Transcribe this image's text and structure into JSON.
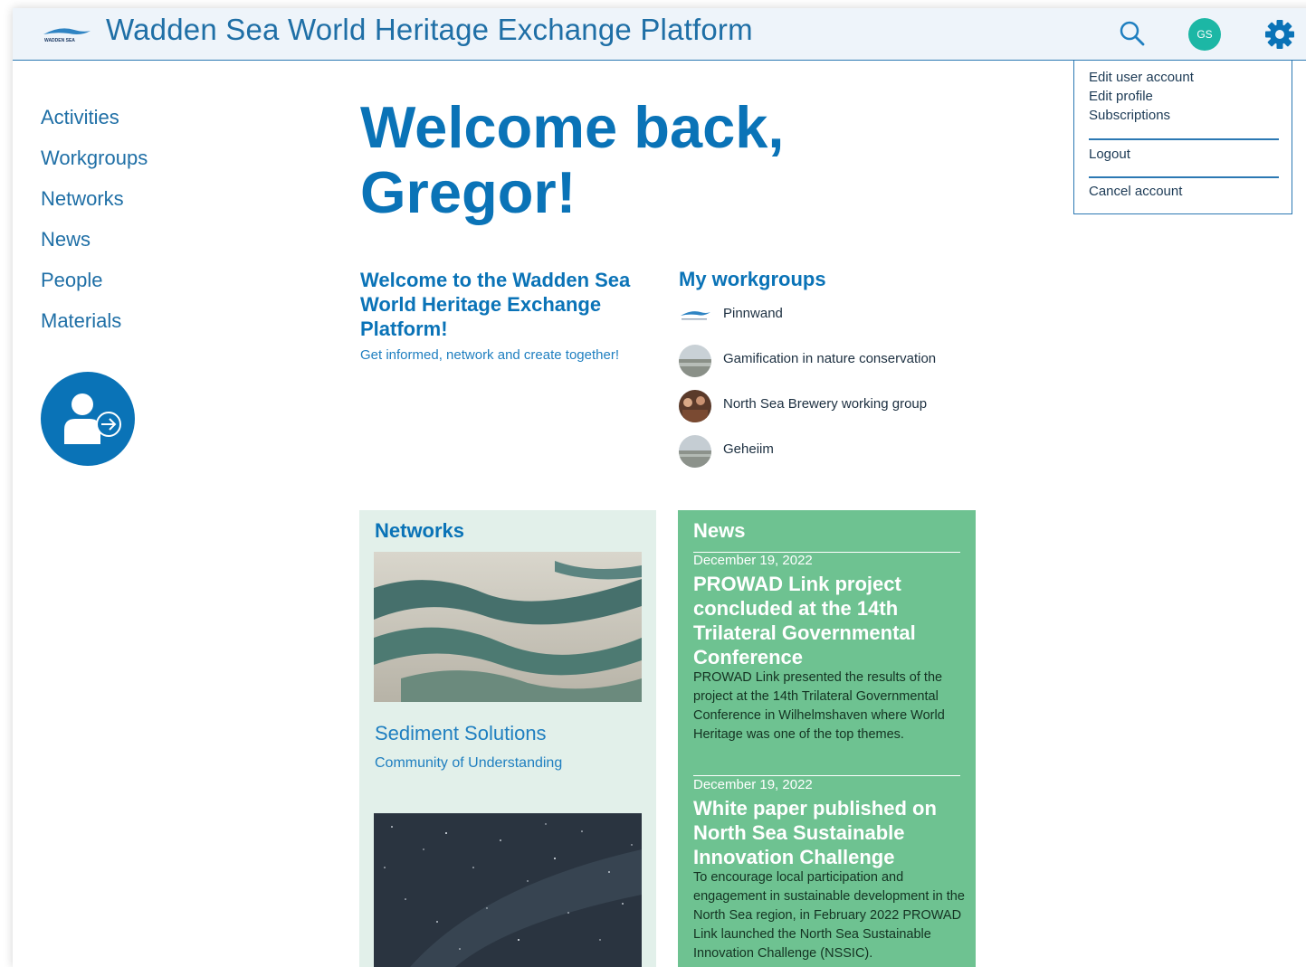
{
  "header": {
    "title": "Wadden Sea World Heritage Exchange Platform",
    "logo_text": "WADDEN SEA",
    "avatar_initials": "GS"
  },
  "account_menu": {
    "items": [
      "Edit user account",
      "Edit profile",
      "Subscriptions"
    ],
    "logout": "Logout",
    "cancel": "Cancel account"
  },
  "sidebar": {
    "items": [
      "Activities",
      "Workgroups",
      "Networks",
      "News",
      "People",
      "Materials"
    ]
  },
  "welcome": {
    "line1": "Welcome back,",
    "line2": "Gregor!"
  },
  "intro": {
    "title": "Welcome to the Wadden Sea World Heritage Exchange Platform!",
    "subtitle": "Get informed, network and create together!"
  },
  "workgroups": {
    "title": "My workgroups",
    "items": [
      "Pinnwand",
      "Gamification in nature conservation",
      "North Sea Brewery working group",
      "Geheiim"
    ]
  },
  "networks": {
    "title": "Networks",
    "items": [
      {
        "name": "Sediment Solutions",
        "subtitle": "Community of Understanding"
      }
    ]
  },
  "news": {
    "title": "News",
    "items": [
      {
        "date": "December 19, 2022",
        "headline": "PROWAD Link project concluded at the 14th Trilateral Governmental Conference",
        "body": "PROWAD Link presented the results of the project at the 14th Trilateral Governmental Conference in Wilhelmshaven where World Heritage was one of the top themes."
      },
      {
        "date": "December 19, 2022",
        "headline": "White paper published on North Sea Sustainable Innovation Challenge",
        "body": "To encourage local participation and engagement in sustainable development in the North Sea region, in February 2022 PROWAD Link launched the North Sea Sustainable Innovation Challenge (NSSIC)."
      }
    ]
  },
  "colors": {
    "brand_blue": "#0a73b7",
    "header_bg": "#eef4fa",
    "avatar_teal": "#1cb7a5",
    "news_green": "#6ec291",
    "networks_bg": "#e2f0ea"
  }
}
